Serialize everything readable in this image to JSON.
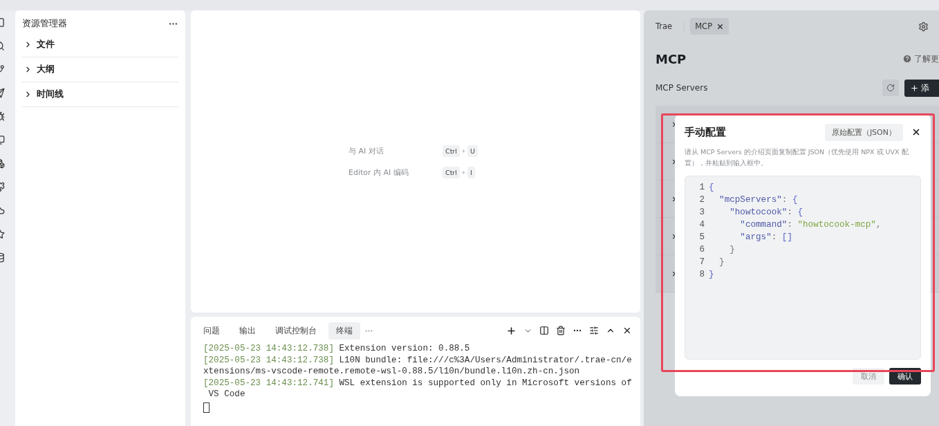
{
  "explorer": {
    "title": "资源管理器",
    "sections": [
      {
        "label": "文件",
        "expanded": false
      },
      {
        "label": "大纲",
        "expanded": false
      },
      {
        "label": "时间线",
        "expanded": false
      }
    ]
  },
  "editor": {
    "hints": [
      {
        "label": "与 AI 对话",
        "keys": [
          "Ctrl",
          "U"
        ]
      },
      {
        "label": "Editor 内 AI 编码",
        "keys": [
          "Ctrl",
          "I"
        ]
      }
    ]
  },
  "panel": {
    "tabs": [
      {
        "label": "问题",
        "selected": false
      },
      {
        "label": "输出",
        "selected": false
      },
      {
        "label": "调试控制台",
        "selected": false
      },
      {
        "label": "终端",
        "selected": true
      }
    ],
    "output": [
      {
        "timestamp": "[2025-05-23 14:43:12.738]",
        "message": " Extension version: 0.88.5"
      },
      {
        "timestamp": "[2025-05-23 14:43:12.738]",
        "message": " L10N bundle: file:///c%3A/Users/Administrator/.trae-cn/e"
      },
      {
        "message": "xtensions/ms-vscode-remote.remote-wsl-0.88.5/l10n/bundle.l10n.zh-cn.json"
      },
      {
        "timestamp": "[2025-05-23 14:43:12.741]",
        "message": " WSL extension is supported only in Microsoft versions of"
      },
      {
        "message": " VS Code"
      }
    ]
  },
  "side_panel": {
    "tabs": [
      {
        "label": "Trae",
        "selected": false,
        "closable": false
      },
      {
        "label": "MCP",
        "selected": true,
        "closable": true
      }
    ],
    "title": "MCP",
    "help_link": "了解更",
    "section_title": "MCP Servers",
    "add_button": "添",
    "servers": [
      {
        "expanded": false
      },
      {
        "expanded": false
      },
      {
        "expanded": false
      },
      {
        "expanded": false
      },
      {
        "expanded": false
      }
    ],
    "dialog": {
      "title": "手动配置",
      "mode_button": "原始配置（JSON）",
      "description": "请从 MCP Servers 的介绍页面复制配置 JSON（优先使用 NPX 或 UVX 配置），并粘贴到输入框中。",
      "code": [
        [
          {
            "kind": "punct",
            "text": "{"
          }
        ],
        [
          {
            "kind": "key",
            "text": "  \"mcpServers\""
          },
          {
            "kind": "plain",
            "text": ": "
          },
          {
            "kind": "punct",
            "text": "{"
          }
        ],
        [
          {
            "kind": "key",
            "text": "    \"howtocook\""
          },
          {
            "kind": "plain",
            "text": ": "
          },
          {
            "kind": "punct",
            "text": "{"
          }
        ],
        [
          {
            "kind": "key",
            "text": "      \"command\""
          },
          {
            "kind": "plain",
            "text": ": "
          },
          {
            "kind": "string",
            "text": "\"howtocook-mcp\""
          },
          {
            "kind": "plain",
            "text": ","
          }
        ],
        [
          {
            "kind": "key",
            "text": "      \"args\""
          },
          {
            "kind": "plain",
            "text": ": "
          },
          {
            "kind": "punct",
            "text": "[]"
          }
        ],
        [
          {
            "kind": "plain",
            "text": "    }"
          }
        ],
        [
          {
            "kind": "plain",
            "text": "  }"
          }
        ],
        [
          {
            "kind": "punct",
            "text": "}"
          }
        ]
      ],
      "line_numbers": [
        "1",
        "2",
        "3",
        "4",
        "5",
        "6",
        "7",
        "8"
      ],
      "buttons": [
        {
          "label": "取消",
          "primary": false
        },
        {
          "label": "确认",
          "primary": true
        }
      ]
    }
  }
}
